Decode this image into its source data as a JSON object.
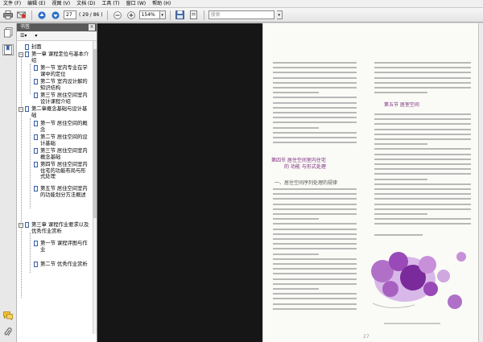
{
  "menu": [
    "文件 (F)",
    "编辑 (E)",
    "视图 (V)",
    "文档 (D)",
    "工具 (T)",
    "窗口 (W)",
    "帮助 (H)"
  ],
  "toolbar": {
    "page_current": "27",
    "page_total": "( 29 / 86 )",
    "zoom": "154%",
    "search_placeholder": "搜索"
  },
  "panel": {
    "title": "书签",
    "close": "×",
    "options": "☰▾",
    "expand": "▾"
  },
  "bookmarks": [
    {
      "label": "封面"
    },
    {
      "label": "第一章 课程定位与基本介绍"
    },
    {
      "label": "第一节 室内专业在学课中的定位"
    },
    {
      "label": "第二节 室内设计解的知识结构"
    },
    {
      "label": "第三节 居住空间室内设计课程介绍"
    },
    {
      "label": "第二章概念基础与设计基础"
    },
    {
      "label": "第一节 居住空间的概念"
    },
    {
      "label": "第二节 居住空间的设计基础"
    },
    {
      "label": "第三节 居住空间室内概念基础"
    },
    {
      "label": "第四节 居住空间室内住宅的功能布局与形式处理"
    },
    {
      "label": "第五节 居住空间室内的功能划分方法概述"
    },
    {
      "label": "第三章 课程作业要求以及优秀作业赏析"
    },
    {
      "label": "第一节 课程评图与作业"
    },
    {
      "label": "第二节 优秀作业赏析"
    }
  ],
  "page": {
    "section_heading_1": "第四节 居住空间室内住宅",
    "section_heading_1b": "的 功能 与形式处理",
    "section_heading_2": "一、居住空间序列处理的规律",
    "right_heading": "第五节 居室空间",
    "page_number": "27"
  },
  "colors": {
    "accent_purple": "#8a3a9a",
    "light_purple": "#c89ad8",
    "bookmark_blue": "#3a62a8",
    "panel_header": "#5a5a5a",
    "viewer_black": "#161616"
  },
  "icons": [
    "print-icon",
    "email-icon",
    "prev-page-icon",
    "next-page-icon",
    "save-icon",
    "zoom-icon",
    "pages-icon",
    "bookmarks-icon",
    "comments-icon",
    "attachments-icon"
  ]
}
